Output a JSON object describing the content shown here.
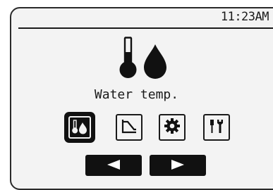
{
  "status_bar": {
    "clock": "11:23AM"
  },
  "main": {
    "mode_title": "Water temp.",
    "mode_icon": "water-temperature-icon"
  },
  "menu": {
    "items": [
      {
        "icon": "water-temperature-icon",
        "selected": true
      },
      {
        "icon": "heating-curve-icon",
        "selected": false
      },
      {
        "icon": "settings-gear-icon",
        "selected": false
      },
      {
        "icon": "service-tools-icon",
        "selected": false
      }
    ]
  },
  "navigation": {
    "left_icon": "arrow-left-icon",
    "right_icon": "arrow-right-icon"
  },
  "colors": {
    "screen_background": "#f3f3f3",
    "foreground": "#111111"
  }
}
